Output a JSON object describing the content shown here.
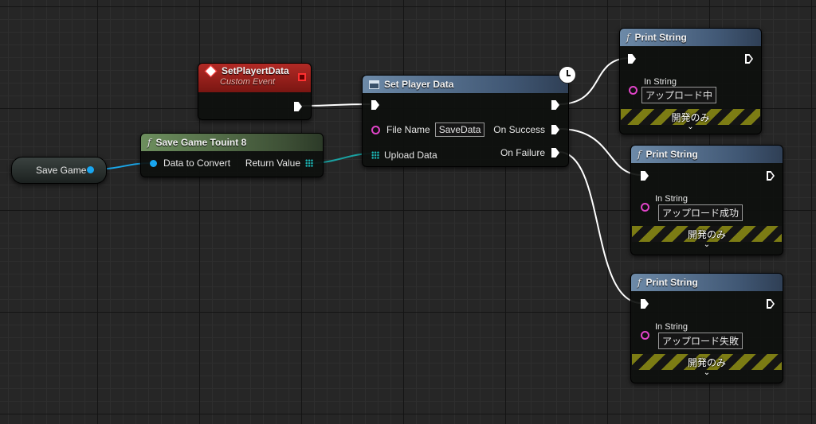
{
  "colors": {
    "exec_wire": "#ffffff",
    "object_wire": "#1aa6e8",
    "array_wire": "#1aa0a0",
    "string_pin": "#e044c8",
    "dev_only_stripe": "#7c7c14"
  },
  "nodes": {
    "save_game_var": {
      "label": "Save Game"
    },
    "custom_event": {
      "title": "SetPlayertData",
      "subtitle": "Custom Event",
      "icon": "event-diamond-icon"
    },
    "save_game_to_uint8": {
      "icon": "function-icon",
      "title": "Save Game Touint 8",
      "input_label": "Data to Convert",
      "output_label": "Return Value"
    },
    "set_player_data": {
      "title": "Set Player Data",
      "latent_icon": "clock-icon",
      "file_name_label": "File Name",
      "file_name_value": "SaveData",
      "upload_data_label": "Upload Data",
      "on_success_label": "On Success",
      "on_failure_label": "On Failure"
    },
    "print_strings": [
      {
        "title": "Print String",
        "in_string_label": "In String",
        "in_string_value": "アップロード中",
        "dev_only_label": "開発のみ"
      },
      {
        "title": "Print String",
        "in_string_label": "In String",
        "in_string_value": "アップロード成功",
        "dev_only_label": "開発のみ"
      },
      {
        "title": "Print String",
        "in_string_label": "In String",
        "in_string_value": "アップロード失敗",
        "dev_only_label": "開発のみ"
      }
    ]
  }
}
